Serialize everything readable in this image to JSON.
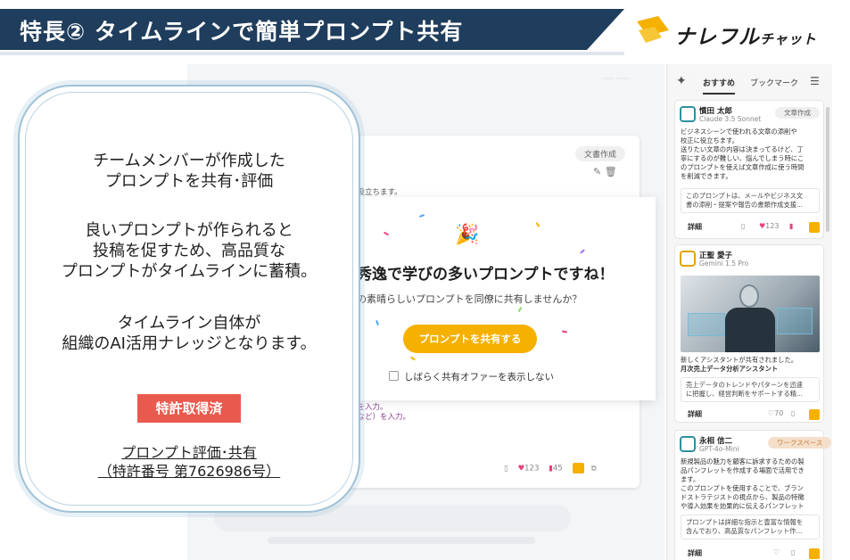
{
  "header": {
    "title": "特長② タイムラインで簡単プロンプト共有",
    "logo_main": "ナレフル",
    "logo_sub": "チャット",
    "colors": {
      "band": "#1f3d5c",
      "accent": "#f5b000"
    }
  },
  "overlay": {
    "para1": [
      "チームメンバーが作成した",
      "プロンプトを共有･評価"
    ],
    "para2": [
      "良いプロンプトが作られると",
      "投稿を促すため、高品質な",
      "プロンプトがタイムラインに蓄積。"
    ],
    "para3": [
      "タイムライン自体が",
      "組織のAI活用ナレッジとなります。"
    ],
    "patent_badge": "特許取得済",
    "patent_link1": "プロンプト評価･共有",
    "patent_link2": "（特許番号 第7626986号）"
  },
  "card": {
    "tag": "文書作成",
    "line1": "校正に役立ちます。",
    "line2": "など）を入力。",
    "line3": "内文書など）を入力。",
    "like_count": "123",
    "bookmark_count": "45"
  },
  "popup": {
    "headline": "秀逸で学びの多いプロンプトですね！",
    "subtext": "の素晴らしいプロンプトを同僚に共有しませんか？",
    "share_button": "プロンプトを共有する",
    "dont_show_label": "しばらく共有オファーを表示しない"
  },
  "sidebar": {
    "tabs": [
      "おすすめ",
      "ブックマーク"
    ],
    "active_tab": "おすすめ",
    "cards": [
      {
        "author": "慣田 太郎",
        "model": "Claude 3.5 Sonnet",
        "badge": "文章作成",
        "desc": [
          "ビジネスシーンで使われる文章の添削や",
          "校正に役立ちます。",
          "送りたい文章の内容は決まってるけど、丁",
          "寧にするのが難しい、悩んでしまう時にこ",
          "のプロンプトを使えば文章作成に使う時間",
          "を削減できます。"
        ],
        "quote": [
          "このプロンプトは、メールやビジネス文",
          "書の添削・提案や報告の書類作成支援..."
        ],
        "detail_label": "詳細",
        "likes": "123"
      },
      {
        "author": "正聖 愛子",
        "model": "Gemini 1.5 Pro",
        "desc": [
          "新しくアシスタントが共有されました。",
          "月次売上データ分析アシスタント"
        ],
        "quote": [
          "売上データのトレンドやパターンを迅速",
          "に把握し、経営判断をサポートする精..."
        ],
        "detail_label": "詳細",
        "likes": "70"
      },
      {
        "author": "永相 信二",
        "model": "GPT-4o-Mini",
        "badge": "ワークスペース",
        "desc": [
          "新規製品の魅力を顧客に訴求するための製",
          "品パンフレットを作成する場面で活用でき",
          "ます。",
          "このプロンプトを使用することで、ブラン",
          "ドストラテジストの視点から、製品の特徴",
          "や導入効果を効果的に伝えるパンフレット"
        ],
        "quote": [
          "プロンプトは詳細な指示と豊富な情報を",
          "含んでおり、高品質なパンフレット作..."
        ],
        "detail_label": "詳細"
      }
    ]
  }
}
